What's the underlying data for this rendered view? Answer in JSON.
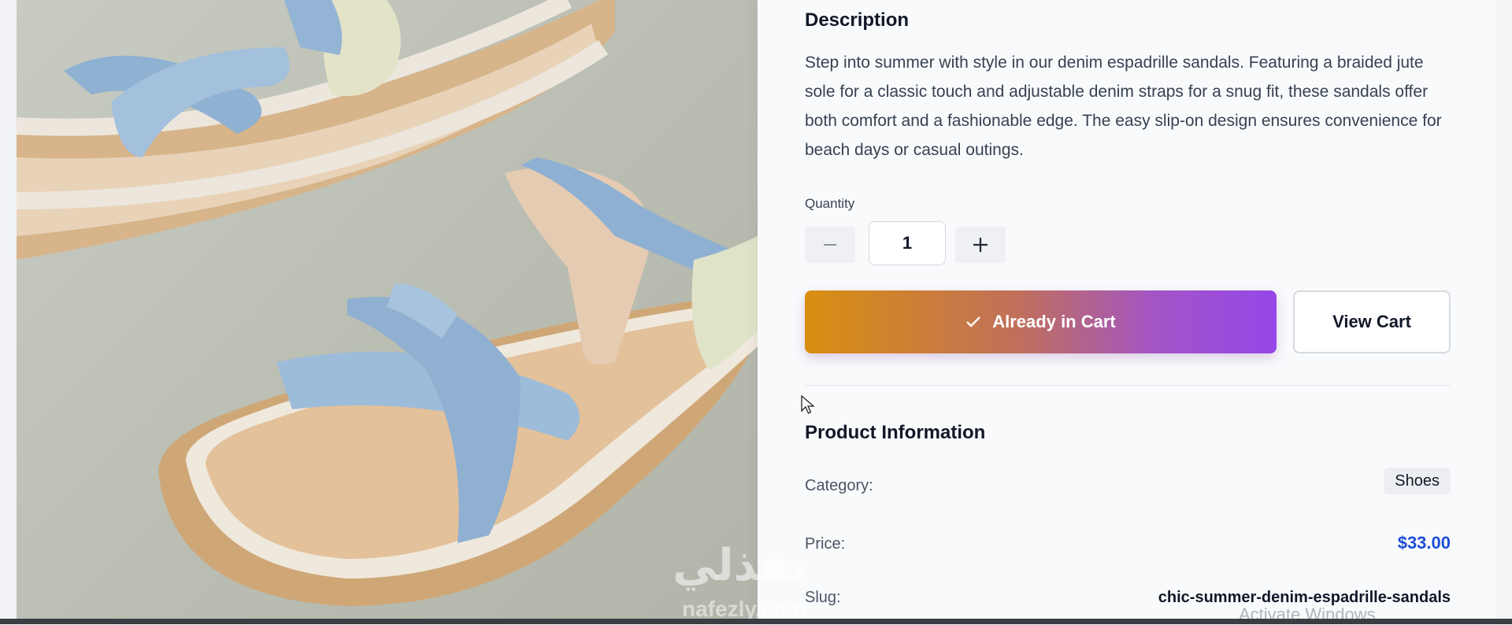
{
  "description": {
    "title": "Description",
    "text": "Step into summer with style in our denim espadrille sandals. Featuring a braided jute sole for a classic touch and adjustable denim straps for a snug fit, these sandals offer both comfort and a fashionable edge. The easy slip-on design ensures convenience for beach days or casual outings."
  },
  "quantity": {
    "label": "Quantity",
    "value": "1",
    "decrease_icon": "minus-icon",
    "increase_icon": "plus-icon"
  },
  "actions": {
    "cart_label": "Already in Cart",
    "cart_icon": "check-icon",
    "view_cart_label": "View Cart"
  },
  "product_info": {
    "title": "Product Information",
    "category_label": "Category:",
    "category_value": "Shoes",
    "price_label": "Price:",
    "price_value": "$33.00",
    "slug_label": "Slug:",
    "slug_value": "chic-summer-denim-espadrille-sandals"
  },
  "overlays": {
    "watermark_main": "نفذلي",
    "watermark_sub": "nafezly.com",
    "activate_windows": "Activate Windows"
  },
  "colors": {
    "cart_gradient_start": "#d98f10",
    "cart_gradient_end": "#9547e8",
    "price": "#1d4ed8"
  }
}
